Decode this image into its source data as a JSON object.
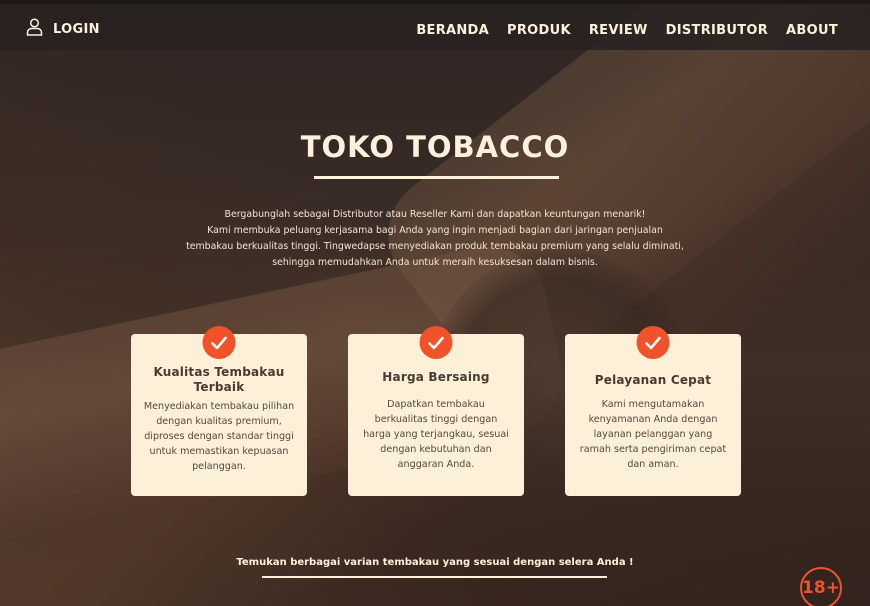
{
  "header": {
    "login_label": "LOGIN",
    "nav": [
      "BERANDA",
      "PRODUK",
      "REVIEW",
      "DISTRIBUTOR",
      "ABOUT"
    ]
  },
  "hero": {
    "title": "TOKO TOBACCO",
    "intro_lines": [
      "Bergabunglah sebagai Distributor atau Reseller Kami dan dapatkan keuntungan menarik!",
      "Kami membuka peluang kerjasama bagi Anda yang ingin menjadi bagian dari jaringan penjualan",
      "tembakau berkualitas tinggi.  Tingwedapse menyediakan produk tembakau premium yang selalu diminati,",
      "sehingga memudahkan Anda untuk meraih kesuksesan dalam bisnis."
    ]
  },
  "features": [
    {
      "title": "Kualitas Tembakau Terbaik",
      "text": "Menyediakan tembakau pilihan dengan kualitas premium, diproses dengan standar tinggi untuk memastikan kepuasan pelanggan."
    },
    {
      "title": "Harga Bersaing",
      "text": "Dapatkan tembakau berkualitas tinggi dengan harga yang terjangkau, sesuai dengan kebutuhan dan anggaran Anda."
    },
    {
      "title": "Pelayanan Cepat",
      "text": "Kami mengutamakan kenyamanan Anda dengan layanan pelanggan yang ramah serta pengiriman cepat dan aman."
    }
  ],
  "footer": {
    "tagline": "Temukan berbagai varian tembakau yang sesuai dengan selera Anda !",
    "age_badge": "18+"
  },
  "icons": {
    "user": "user-icon",
    "check": "check-icon"
  },
  "colors": {
    "accent": "#f0522a",
    "cream": "#fdf0d8",
    "text_light": "#fdf1dc",
    "card_text": "#5a463d"
  }
}
